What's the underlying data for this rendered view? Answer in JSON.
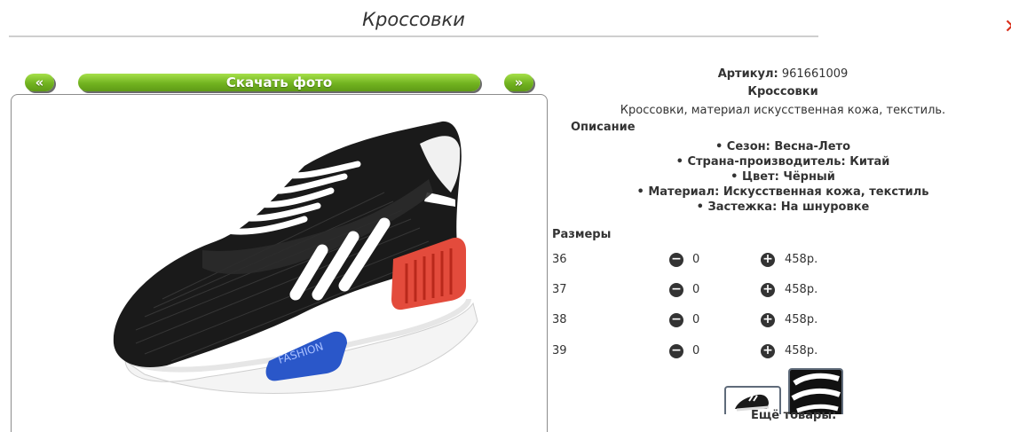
{
  "page": {
    "title": "Кроссовки"
  },
  "gallery": {
    "prev_label": "«",
    "download_label": "Скачать фото",
    "next_label": "»"
  },
  "product": {
    "article_label": "Артикул:",
    "article_value": "961661009",
    "name": "Кроссовки",
    "short_description": "Кроссовки, материал искусственная кожа, текстиль.",
    "description_heading": "Описание",
    "features": [
      "• Сезон: Весна-Лето",
      "• Страна-производитель: Китай",
      "• Цвет: Чёрный",
      "• Материал: Искусственная кожа, текстиль",
      "• Застежка: На шнуровке"
    ]
  },
  "sizes": {
    "heading": "Размеры",
    "rows": [
      {
        "size": "36",
        "qty": "0",
        "price": "458р."
      },
      {
        "size": "37",
        "qty": "0",
        "price": "458р."
      },
      {
        "size": "38",
        "qty": "0",
        "price": "458р."
      },
      {
        "size": "39",
        "qty": "0",
        "price": "458р."
      }
    ]
  },
  "more": {
    "label": "Ещё товары:"
  },
  "colors": {
    "button_green": "#72b320",
    "close_red": "#d9301c"
  }
}
